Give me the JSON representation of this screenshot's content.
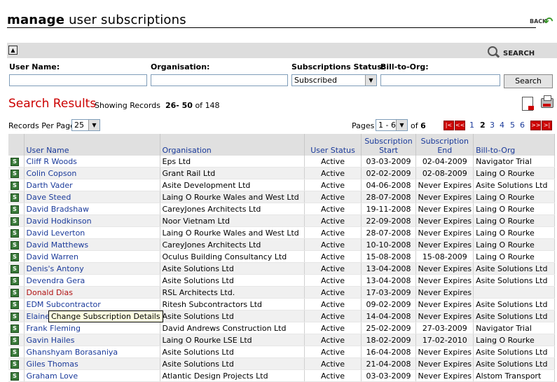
{
  "header": {
    "title_bold": "manage",
    "title_rest": "user subscriptions",
    "back_label": "BACK"
  },
  "searchbar": {
    "search_link": "SEARCH"
  },
  "filters": {
    "user_name_label": "User Name:",
    "organisation_label": "Organisation:",
    "status_label": "Subscriptions Status:",
    "bill_label": "Bill-to-Org:",
    "user_name_value": "",
    "organisation_value": "",
    "status_value": "Subscribed",
    "bill_value": "",
    "search_button": "Search"
  },
  "results": {
    "title": "Search Results",
    "showing_prefix": "Showing Records",
    "range": "26- 50",
    "of_word": "of",
    "total": "148"
  },
  "paging": {
    "rpp_label": "Records Per Page",
    "rpp_value": "25",
    "pages_label": "Pages",
    "pages_value": "1 - 6",
    "of_word": "of",
    "page_count": "6",
    "first": "|<",
    "prev": "<<",
    "next": ">>",
    "last": ">|",
    "numbers": [
      "1",
      "2",
      "3",
      "4",
      "5",
      "6"
    ],
    "current": "2"
  },
  "table": {
    "headers": {
      "user_name": "User Name",
      "organisation": "Organisation",
      "status": "User Status",
      "start": "Subscription Start",
      "end": "Subscription End",
      "bill": "Bill-to-Org"
    },
    "rows": [
      {
        "name": "Cliff R Woods",
        "org": "Eps Ltd",
        "status": "Active",
        "start": "03-03-2009",
        "end": "02-04-2009",
        "bill": "Navigator Trial"
      },
      {
        "name": "Colin Copson",
        "org": "Grant Rail Ltd",
        "status": "Active",
        "start": "02-02-2009",
        "end": "02-08-2009",
        "bill": "Laing O Rourke"
      },
      {
        "name": "Darth Vader",
        "org": "Asite Development Ltd",
        "status": "Active",
        "start": "04-06-2008",
        "end": "Never Expires",
        "bill": "Asite Solutions Ltd"
      },
      {
        "name": "Dave Steed",
        "org": "Laing O Rourke Wales and West Ltd",
        "status": "Active",
        "start": "28-07-2008",
        "end": "Never Expires",
        "bill": "Laing O Rourke"
      },
      {
        "name": "David Bradshaw",
        "org": "CareyJones Architects Ltd",
        "status": "Active",
        "start": "19-11-2008",
        "end": "Never Expires",
        "bill": "Laing O Rourke"
      },
      {
        "name": "David Hodkinson",
        "org": "Noor Vietnam Ltd",
        "status": "Active",
        "start": "22-09-2008",
        "end": "Never Expires",
        "bill": "Laing O Rourke"
      },
      {
        "name": "David Leverton",
        "org": "Laing O Rourke Wales and West Ltd",
        "status": "Active",
        "start": "28-07-2008",
        "end": "Never Expires",
        "bill": "Laing O Rourke"
      },
      {
        "name": "David Matthews",
        "org": "CareyJones Architects Ltd",
        "status": "Active",
        "start": "10-10-2008",
        "end": "Never Expires",
        "bill": "Laing O Rourke"
      },
      {
        "name": "David Warren",
        "org": "Oculus Building Consultancy Ltd",
        "status": "Active",
        "start": "15-08-2008",
        "end": "15-08-2009",
        "bill": "Laing O Rourke"
      },
      {
        "name": "Denis's Antony",
        "org": "Asite Solutions Ltd",
        "status": "Active",
        "start": "13-04-2008",
        "end": "Never Expires",
        "bill": "Asite Solutions Ltd"
      },
      {
        "name": "Devendra Gera",
        "org": "Asite Solutions Ltd",
        "status": "Active",
        "start": "13-04-2008",
        "end": "Never Expires",
        "bill": "Asite Solutions Ltd"
      },
      {
        "name": "Donald Dias",
        "org": "RSL Architects Ltd.",
        "status": "Active",
        "start": "17-03-2009",
        "end": "Never Expires",
        "bill": ""
      },
      {
        "name": "EDM Subcontractor",
        "org": "Ritesh Subcontractors Ltd",
        "status": "Active",
        "start": "09-02-2009",
        "end": "Never Expires",
        "bill": "Asite Solutions Ltd"
      },
      {
        "name": "Elaine",
        "org": "Asite Solutions Ltd",
        "status": "Active",
        "start": "14-04-2008",
        "end": "Never Expires",
        "bill": "Asite Solutions Ltd"
      },
      {
        "name": "Frank Fleming",
        "org": "David Andrews Construction Ltd",
        "status": "Active",
        "start": "25-02-2009",
        "end": "27-03-2009",
        "bill": "Navigator Trial"
      },
      {
        "name": "Gavin Hailes",
        "org": "Laing O Rourke LSE Ltd",
        "status": "Active",
        "start": "18-02-2009",
        "end": "17-02-2010",
        "bill": "Laing O Rourke"
      },
      {
        "name": "Ghanshyam Borasaniya",
        "org": "Asite Solutions Ltd",
        "status": "Active",
        "start": "16-04-2008",
        "end": "Never Expires",
        "bill": "Asite Solutions Ltd"
      },
      {
        "name": "Giles Thomas",
        "org": "Asite Solutions Ltd",
        "status": "Active",
        "start": "21-04-2008",
        "end": "Never Expires",
        "bill": "Asite Solutions Ltd"
      },
      {
        "name": "Graham Love",
        "org": "Atlantic Design Projects Ltd",
        "status": "Active",
        "start": "03-03-2009",
        "end": "Never Expires",
        "bill": "Alstom Transport"
      }
    ],
    "row_icon": "S"
  },
  "tooltip": "Change Subscription Details",
  "icons": {
    "back": "back-arrow-icon",
    "search": "magnifier-icon",
    "export": "export-icon",
    "print": "printer-icon",
    "subscription": "subscription-icon"
  }
}
